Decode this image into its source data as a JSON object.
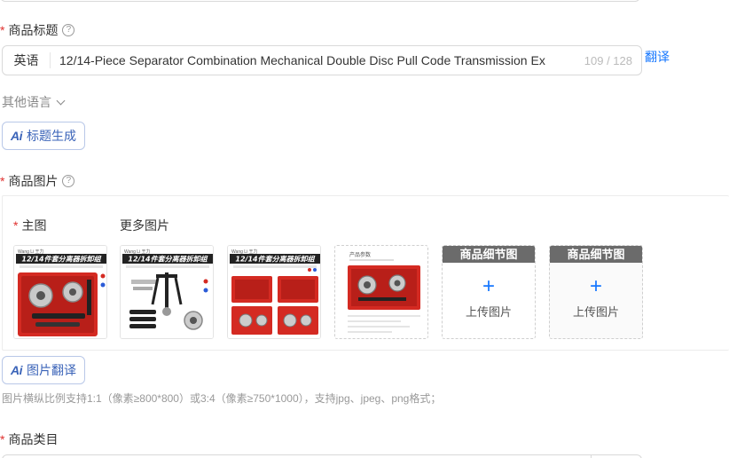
{
  "fields": {
    "title": {
      "label": "商品标题",
      "required_mark": "*",
      "help_icon": "question-circle-icon",
      "language": "英语",
      "value": "12/14-Piece Separator Combination Mechanical Double Disc Pull Code Transmission Ex",
      "counter": "109 / 128",
      "translate_link": "翻译"
    },
    "other_languages": {
      "label": "其他语言"
    },
    "ai_title_button": {
      "icon_text": "Ai",
      "label": "标题生成"
    },
    "images": {
      "label": "商品图片",
      "required_mark": "*",
      "help_icon": "question-circle-icon",
      "main_image_label": "主图",
      "more_images_label": "更多图片",
      "thumb1": {
        "banner": "12/14件套分离器拆卸组",
        "brand": "Wang Li 王力"
      },
      "thumb2": {
        "banner": "12/14件套分离器拆卸组",
        "brand": "Wang Li 王力"
      },
      "thumb3": {
        "banner": "12/14件套分离器拆卸组",
        "brand": "Wang Li 王力"
      },
      "thumb4": {
        "caption": "产品参数"
      },
      "upload_slots": [
        {
          "header": "商品细节图",
          "plus": "+",
          "label": "上传图片"
        },
        {
          "header": "商品细节图",
          "plus": "+",
          "label": "上传图片"
        }
      ]
    },
    "ai_image_button": {
      "icon_text": "Ai",
      "label": "图片翻译"
    },
    "image_hint": "图片横纵比例支持1:1（像素≥800*800）或3:4（像素≥750*1000），支持jpg、jpeg、png格式；",
    "category": {
      "label": "商品类目",
      "required_mark": "*"
    }
  },
  "colors": {
    "required": "#e0312f",
    "link": "#1677ff",
    "ai_accent": "#3a63b8",
    "product_red": "#d42a22"
  }
}
